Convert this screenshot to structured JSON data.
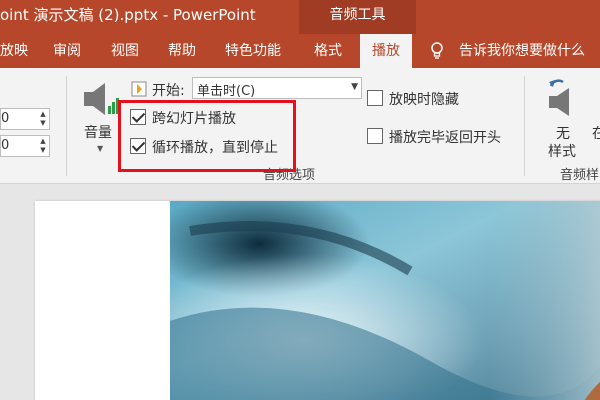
{
  "window": {
    "title": "oint 演示文稿 (2).pptx - PowerPoint"
  },
  "context_group": {
    "label": "音频工具"
  },
  "tabs": [
    {
      "label": "放映"
    },
    {
      "label": "审阅"
    },
    {
      "label": "视图"
    },
    {
      "label": "帮助"
    },
    {
      "label": "特色功能"
    },
    {
      "label": "格式"
    },
    {
      "label": "播放",
      "active": true
    }
  ],
  "tell_me": {
    "text": "告诉我你想要做什么"
  },
  "fade": {
    "in_value": "0",
    "out_value": "0"
  },
  "volume": {
    "label": "音量"
  },
  "start": {
    "label": "开始:",
    "value": "单击时(C)"
  },
  "options": {
    "hide_during_show": {
      "label": "放映时隐藏",
      "checked": false
    },
    "play_across_slides": {
      "label": "跨幻灯片播放",
      "checked": true
    },
    "rewind_after_playing": {
      "label": "播放完毕返回开头",
      "checked": false
    },
    "loop_until_stopped": {
      "label": "循环播放，直到停止",
      "checked": true
    },
    "group_label": "音频选项"
  },
  "audio_styles": {
    "no_style_label_line1": "无",
    "no_style_label_line2": "样式",
    "partial_label": "在",
    "group_label": "音频样"
  },
  "colors": {
    "accent": "#b7472a",
    "context_tab_bg": "#a03c23",
    "highlight_border": "#e4101b",
    "ribbon_bg": "#f3f3f3"
  }
}
